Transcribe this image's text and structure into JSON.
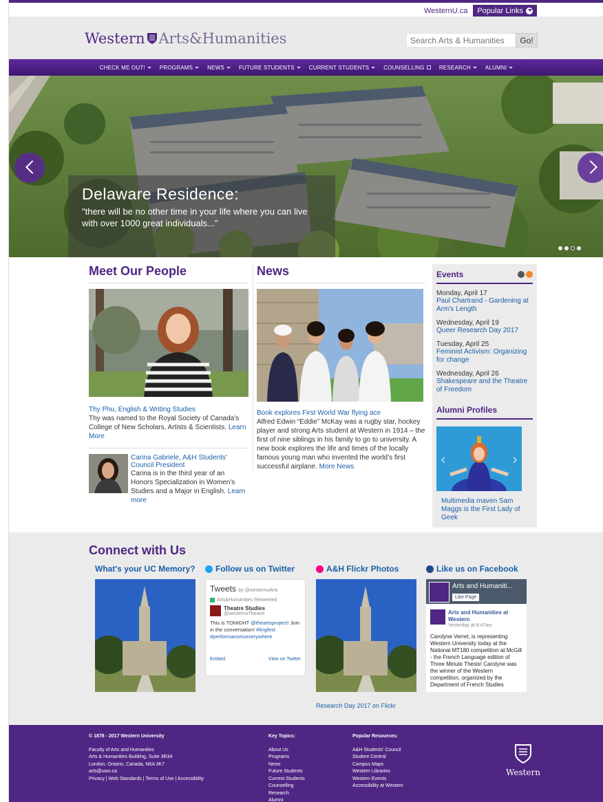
{
  "util": {
    "westernu": "WesternU.ca",
    "popular": "Popular Links"
  },
  "header": {
    "logo_main": "Western",
    "logo_section": "Arts&Humanities",
    "search_placeholder": "Search Arts & Humanities",
    "go": "Go!"
  },
  "nav": [
    {
      "label": "CHECK ME OUT!",
      "caret": true
    },
    {
      "label": "PROGRAMS",
      "caret": true
    },
    {
      "label": "NEWS",
      "caret": true
    },
    {
      "label": "FUTURE STUDENTS",
      "caret": true
    },
    {
      "label": "CURRENT STUDENTS",
      "caret": true
    },
    {
      "label": "COUNSELLING",
      "external": true
    },
    {
      "label": "RESEARCH",
      "caret": true
    },
    {
      "label": "ALUMNI",
      "caret": true
    }
  ],
  "hero": {
    "title": "Delaware Residence:",
    "text": "\"there will be no other time in your life where you can live with over 1000 great individuals...\"",
    "slide_count": 4,
    "active_slide": 3
  },
  "people": {
    "heading": "Meet Our People",
    "p1_name": "Thy Phu, English & Writing Studies",
    "p1_text": "Thy was named to the Royal Society of Canada's College of New Scholars, Artists & Scientists.",
    "p1_more": "Learn More",
    "p2_name": "Carina Gabriele, A&H Students' Council President",
    "p2_text": "Carina is in the third year of an Honors Specialization in Women's Studies and a Major in English.",
    "p2_more": "Learn more"
  },
  "news": {
    "heading": "News",
    "title": "Book explores First World War flying ace",
    "text": "Alfred Edwin “Eddie” McKay was a rugby star, hockey player and strong Arts student at Western in 1914 – the first of nine siblings in his family to go to university. A new book explores the life and times of the locally famous young man who invented the world’s first successful airplane.",
    "more": "More News"
  },
  "events": {
    "heading": "Events",
    "items": [
      {
        "date": "Monday, April 17",
        "title": "Paul Chartrand - Gardening at Arm's Length"
      },
      {
        "date": "Wednesday, April 19",
        "title": "Queer Research Day 2017"
      },
      {
        "date": "Tuesday, April 25",
        "title": "Feminist Activism: Organizing for change"
      },
      {
        "date": "Wednesday, April 26",
        "title": "Shakespeare and the Theatre of Freedom"
      }
    ]
  },
  "alumni": {
    "heading": "Alumni Profiles",
    "caption": "Multimedia maven Sam Maggs is the First Lady of Geek"
  },
  "connect": {
    "heading": "Connect with Us",
    "uc": "What's your UC Memory?",
    "twitter": "Follow us on Twitter",
    "flickr": "A&H Flickr Photos",
    "facebook": "Like us on Facebook",
    "flickr_caption": "Research Day 2017 on Flickr",
    "tw": {
      "title": "Tweets",
      "by": "by @westernuArts",
      "retweeted": "Arts&Humanities Retweeted",
      "name": "Theatre Studies",
      "handle": "@westernuTheatre",
      "msg1": "This is TONIGHT",
      "mention": "@theartsproject!",
      "msg2": "Join in the conversation!",
      "tags": "#lingfest #performanceiseverywhere",
      "embed": "Embed",
      "view": "View on Twitter"
    },
    "fb": {
      "page": "Arts and Humaniti...",
      "like": "Like Page",
      "poster": "Arts and Humanities at Western",
      "time": "Yesterday at 8:47am",
      "body": "Carolyne Verret, is representing Western University today at the National MT180 competition at McGill - the French Language edition of Three Minute Thesis! Carolyne was the winner of the Western competition, organized by the Department of French Studies"
    }
  },
  "footer": {
    "copyright": "© 1878 - 2017 Western University",
    "address": [
      "Faculty of Arts and Humanities",
      "Arts & Humanities Building, Suite 3R34",
      "London, Ontario, Canada, N6A 3K7",
      "arts@uwo.ca",
      "Privacy | Web Standards | Terms of Use | Accessibility"
    ],
    "key_heading": "Key Topics:",
    "key": [
      "About Us",
      "Programs",
      "News",
      "Future Students",
      "Current Students",
      "Counselling",
      "Research",
      "Alumni"
    ],
    "pop_heading": "Popular Resources:",
    "pop": [
      "A&H Students' Council",
      "Student Central",
      "Campus Maps",
      "Western Libraries",
      "Western Events",
      "Accessibility at Western"
    ],
    "wordmark": "Western"
  },
  "colors": {
    "purple": "#4f2683",
    "link": "#1a5ea7",
    "band": "#ebebeb"
  }
}
